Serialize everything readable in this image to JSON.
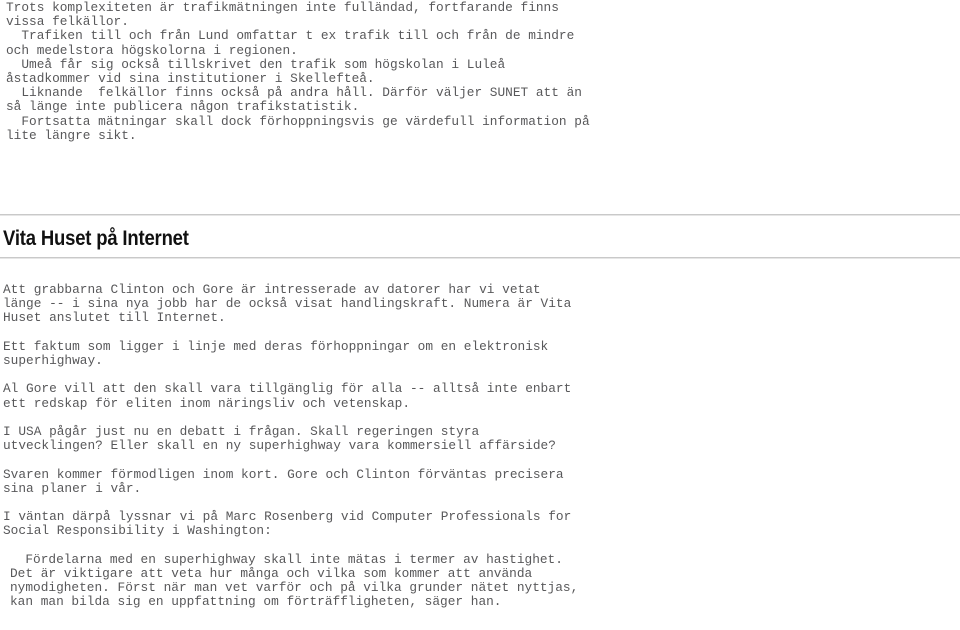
{
  "document": {
    "intro_section": {
      "paragraphs": [
        "Trots komplexiteten är trafikmätningen inte fulländad, fortfarande finns\nvissa felkällor.\n  Trafiken till och från Lund omfattar t ex trafik till och från de mindre\noch medelstora högskolorna i regionen.\n  Umeå får sig också tillskrivet den trafik som högskolan i Luleå\nåstadkommer vid sina institutioner i Skellefteå.\n  Liknande  felkällor finns också på andra håll. Därför väljer SUNET att än\nså länge inte publicera någon trafikstatistik.\n  Fortsatta mätningar skall dock förhoppningsvis ge värdefull information på\nlite längre sikt."
      ]
    },
    "article": {
      "heading": "Vita Huset på Internet",
      "paragraphs": [
        "Att grabbarna Clinton och Gore är intresserade av datorer har vi vetat\nlänge -- i sina nya jobb har de också visat handlingskraft. Numera är Vita\nHuset anslutet till Internet.",
        "Ett faktum som ligger i linje med deras förhoppningar om en elektronisk\nsuperhighway.",
        "Al Gore vill att den skall vara tillgänglig för alla -- alltså inte enbart\nett redskap för eliten inom näringsliv och vetenskap.",
        "I USA pågår just nu en debatt i frågan. Skall regeringen styra\nutvecklingen? Eller skall en ny superhighway vara kommersiell affärside?",
        "Svaren kommer förmodligen inom kort. Gore och Clinton förväntas precisera\nsina planer i vår.",
        "I väntan därpå lyssnar vi på Marc Rosenberg vid Computer Professionals for\nSocial Responsibility i Washington:"
      ],
      "quote": "  Fördelarna med en superhighway skall inte mätas i termer av hastighet.\nDet är viktigare att veta hur många och vilka som kommer att använda\nnymodigheten. Först när man vet varför och på vilka grunder nätet nyttjas,\nkan man bilda sig en uppfattning om förträffligheten, säger han."
    }
  },
  "style": {
    "body_text_color": "#58585a",
    "heading_color": "#111111",
    "rule_color": "#c9c9c9",
    "background_color": "#ffffff"
  }
}
